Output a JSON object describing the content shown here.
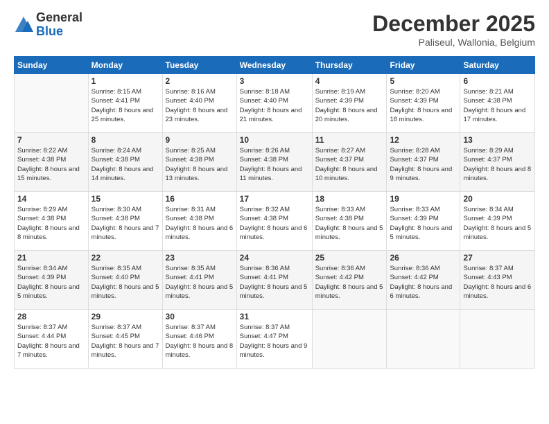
{
  "logo": {
    "general": "General",
    "blue": "Blue"
  },
  "header": {
    "month": "December 2025",
    "location": "Paliseul, Wallonia, Belgium"
  },
  "weekdays": [
    "Sunday",
    "Monday",
    "Tuesday",
    "Wednesday",
    "Thursday",
    "Friday",
    "Saturday"
  ],
  "weeks": [
    [
      {
        "day": "",
        "sunrise": "",
        "sunset": "",
        "daylight": ""
      },
      {
        "day": "1",
        "sunrise": "Sunrise: 8:15 AM",
        "sunset": "Sunset: 4:41 PM",
        "daylight": "Daylight: 8 hours and 25 minutes."
      },
      {
        "day": "2",
        "sunrise": "Sunrise: 8:16 AM",
        "sunset": "Sunset: 4:40 PM",
        "daylight": "Daylight: 8 hours and 23 minutes."
      },
      {
        "day": "3",
        "sunrise": "Sunrise: 8:18 AM",
        "sunset": "Sunset: 4:40 PM",
        "daylight": "Daylight: 8 hours and 21 minutes."
      },
      {
        "day": "4",
        "sunrise": "Sunrise: 8:19 AM",
        "sunset": "Sunset: 4:39 PM",
        "daylight": "Daylight: 8 hours and 20 minutes."
      },
      {
        "day": "5",
        "sunrise": "Sunrise: 8:20 AM",
        "sunset": "Sunset: 4:39 PM",
        "daylight": "Daylight: 8 hours and 18 minutes."
      },
      {
        "day": "6",
        "sunrise": "Sunrise: 8:21 AM",
        "sunset": "Sunset: 4:38 PM",
        "daylight": "Daylight: 8 hours and 17 minutes."
      }
    ],
    [
      {
        "day": "7",
        "sunrise": "Sunrise: 8:22 AM",
        "sunset": "Sunset: 4:38 PM",
        "daylight": "Daylight: 8 hours and 15 minutes."
      },
      {
        "day": "8",
        "sunrise": "Sunrise: 8:24 AM",
        "sunset": "Sunset: 4:38 PM",
        "daylight": "Daylight: 8 hours and 14 minutes."
      },
      {
        "day": "9",
        "sunrise": "Sunrise: 8:25 AM",
        "sunset": "Sunset: 4:38 PM",
        "daylight": "Daylight: 8 hours and 13 minutes."
      },
      {
        "day": "10",
        "sunrise": "Sunrise: 8:26 AM",
        "sunset": "Sunset: 4:38 PM",
        "daylight": "Daylight: 8 hours and 11 minutes."
      },
      {
        "day": "11",
        "sunrise": "Sunrise: 8:27 AM",
        "sunset": "Sunset: 4:37 PM",
        "daylight": "Daylight: 8 hours and 10 minutes."
      },
      {
        "day": "12",
        "sunrise": "Sunrise: 8:28 AM",
        "sunset": "Sunset: 4:37 PM",
        "daylight": "Daylight: 8 hours and 9 minutes."
      },
      {
        "day": "13",
        "sunrise": "Sunrise: 8:29 AM",
        "sunset": "Sunset: 4:37 PM",
        "daylight": "Daylight: 8 hours and 8 minutes."
      }
    ],
    [
      {
        "day": "14",
        "sunrise": "Sunrise: 8:29 AM",
        "sunset": "Sunset: 4:38 PM",
        "daylight": "Daylight: 8 hours and 8 minutes."
      },
      {
        "day": "15",
        "sunrise": "Sunrise: 8:30 AM",
        "sunset": "Sunset: 4:38 PM",
        "daylight": "Daylight: 8 hours and 7 minutes."
      },
      {
        "day": "16",
        "sunrise": "Sunrise: 8:31 AM",
        "sunset": "Sunset: 4:38 PM",
        "daylight": "Daylight: 8 hours and 6 minutes."
      },
      {
        "day": "17",
        "sunrise": "Sunrise: 8:32 AM",
        "sunset": "Sunset: 4:38 PM",
        "daylight": "Daylight: 8 hours and 6 minutes."
      },
      {
        "day": "18",
        "sunrise": "Sunrise: 8:33 AM",
        "sunset": "Sunset: 4:38 PM",
        "daylight": "Daylight: 8 hours and 5 minutes."
      },
      {
        "day": "19",
        "sunrise": "Sunrise: 8:33 AM",
        "sunset": "Sunset: 4:39 PM",
        "daylight": "Daylight: 8 hours and 5 minutes."
      },
      {
        "day": "20",
        "sunrise": "Sunrise: 8:34 AM",
        "sunset": "Sunset: 4:39 PM",
        "daylight": "Daylight: 8 hours and 5 minutes."
      }
    ],
    [
      {
        "day": "21",
        "sunrise": "Sunrise: 8:34 AM",
        "sunset": "Sunset: 4:39 PM",
        "daylight": "Daylight: 8 hours and 5 minutes."
      },
      {
        "day": "22",
        "sunrise": "Sunrise: 8:35 AM",
        "sunset": "Sunset: 4:40 PM",
        "daylight": "Daylight: 8 hours and 5 minutes."
      },
      {
        "day": "23",
        "sunrise": "Sunrise: 8:35 AM",
        "sunset": "Sunset: 4:41 PM",
        "daylight": "Daylight: 8 hours and 5 minutes."
      },
      {
        "day": "24",
        "sunrise": "Sunrise: 8:36 AM",
        "sunset": "Sunset: 4:41 PM",
        "daylight": "Daylight: 8 hours and 5 minutes."
      },
      {
        "day": "25",
        "sunrise": "Sunrise: 8:36 AM",
        "sunset": "Sunset: 4:42 PM",
        "daylight": "Daylight: 8 hours and 5 minutes."
      },
      {
        "day": "26",
        "sunrise": "Sunrise: 8:36 AM",
        "sunset": "Sunset: 4:42 PM",
        "daylight": "Daylight: 8 hours and 6 minutes."
      },
      {
        "day": "27",
        "sunrise": "Sunrise: 8:37 AM",
        "sunset": "Sunset: 4:43 PM",
        "daylight": "Daylight: 8 hours and 6 minutes."
      }
    ],
    [
      {
        "day": "28",
        "sunrise": "Sunrise: 8:37 AM",
        "sunset": "Sunset: 4:44 PM",
        "daylight": "Daylight: 8 hours and 7 minutes."
      },
      {
        "day": "29",
        "sunrise": "Sunrise: 8:37 AM",
        "sunset": "Sunset: 4:45 PM",
        "daylight": "Daylight: 8 hours and 7 minutes."
      },
      {
        "day": "30",
        "sunrise": "Sunrise: 8:37 AM",
        "sunset": "Sunset: 4:46 PM",
        "daylight": "Daylight: 8 hours and 8 minutes."
      },
      {
        "day": "31",
        "sunrise": "Sunrise: 8:37 AM",
        "sunset": "Sunset: 4:47 PM",
        "daylight": "Daylight: 8 hours and 9 minutes."
      },
      {
        "day": "",
        "sunrise": "",
        "sunset": "",
        "daylight": ""
      },
      {
        "day": "",
        "sunrise": "",
        "sunset": "",
        "daylight": ""
      },
      {
        "day": "",
        "sunrise": "",
        "sunset": "",
        "daylight": ""
      }
    ]
  ]
}
